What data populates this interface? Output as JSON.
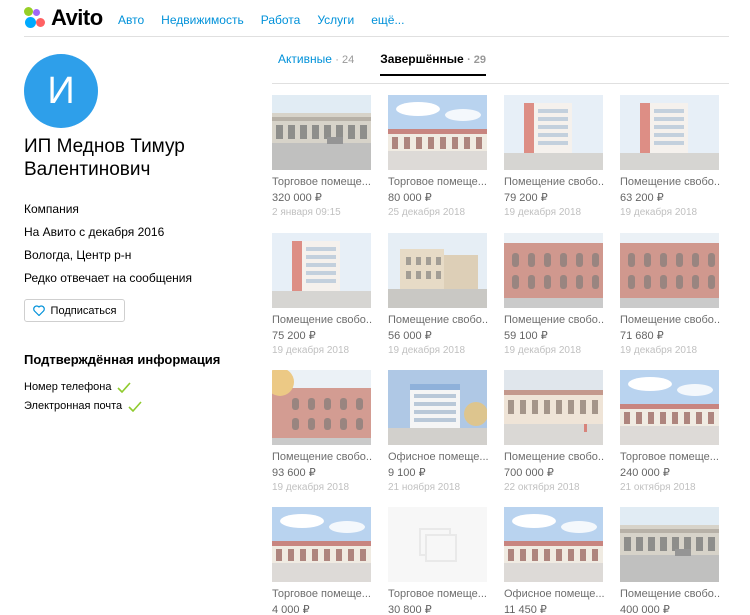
{
  "header": {
    "logo": "Avito",
    "nav": [
      "Авто",
      "Недвижимость",
      "Работа",
      "Услуги",
      "ещё..."
    ]
  },
  "profile": {
    "avatar_letter": "И",
    "name": "ИП Меднов Тимур Валентинович",
    "type": "Компания",
    "since": "На Авито с декабря 2016",
    "location": "Вологда, Центр р-н",
    "response": "Редко отвечает на сообщения",
    "subscribe_label": "Подписаться",
    "verified_title": "Подтверждённая информация",
    "verified": [
      "Номер телефона",
      "Электронная почта"
    ]
  },
  "tabs": [
    {
      "label": "Активные",
      "count": "· 24"
    },
    {
      "label": "Завершённые",
      "count": "· 29"
    }
  ],
  "listings": [
    {
      "title": "Торговое помеще...",
      "price": "320 000 ₽",
      "date": "2 января 09:15",
      "image": "arcade-street"
    },
    {
      "title": "Торговое помеще...",
      "price": "80 000 ₽",
      "date": "25 декабря 2018",
      "image": "red-facade"
    },
    {
      "title": "Помещение свобо...",
      "price": "79 200 ₽",
      "date": "19 декабря 2018",
      "image": "tower"
    },
    {
      "title": "Помещение свобо...",
      "price": "63 200 ₽",
      "date": "19 декабря 2018",
      "image": "tower"
    },
    {
      "title": "Помещение свобо...",
      "price": "75 200 ₽",
      "date": "19 декабря 2018",
      "image": "tower"
    },
    {
      "title": "Помещение свобо...",
      "price": "56 000 ₽",
      "date": "19 декабря 2018",
      "image": "beige-building"
    },
    {
      "title": "Помещение свобо...",
      "price": "59 100 ₽",
      "date": "19 декабря 2018",
      "image": "brick-building"
    },
    {
      "title": "Помещение свобо...",
      "price": "71 680 ₽",
      "date": "19 декабря 2018",
      "image": "brick-building"
    },
    {
      "title": "Помещение свобо...",
      "price": "93 600 ₽",
      "date": "19 декабря 2018",
      "image": "brick-tree"
    },
    {
      "title": "Офисное помеще...",
      "price": "9 100 ₽",
      "date": "21 ноября 2018",
      "image": "office"
    },
    {
      "title": "Помещение свобо...",
      "price": "700 000 ₽",
      "date": "22 октября 2018",
      "image": "long-building"
    },
    {
      "title": "Торговое помеще...",
      "price": "240 000 ₽",
      "date": "21 октября 2018",
      "image": "red-facade"
    },
    {
      "title": "Торговое помеще...",
      "price": "4 000 ₽",
      "date": "",
      "image": "red-facade"
    },
    {
      "title": "Торговое помеще...",
      "price": "30 800 ₽",
      "date": "",
      "image": "placeholder"
    },
    {
      "title": "Офисное помеще...",
      "price": "11 450 ₽",
      "date": "",
      "image": "red-facade"
    },
    {
      "title": "Помещение свобо...",
      "price": "400 000 ₽",
      "date": "",
      "image": "arcade-street"
    }
  ],
  "colors": {
    "accent": "#0091d9",
    "avatar": "#2e9fea",
    "check": "#8fcb2e"
  }
}
